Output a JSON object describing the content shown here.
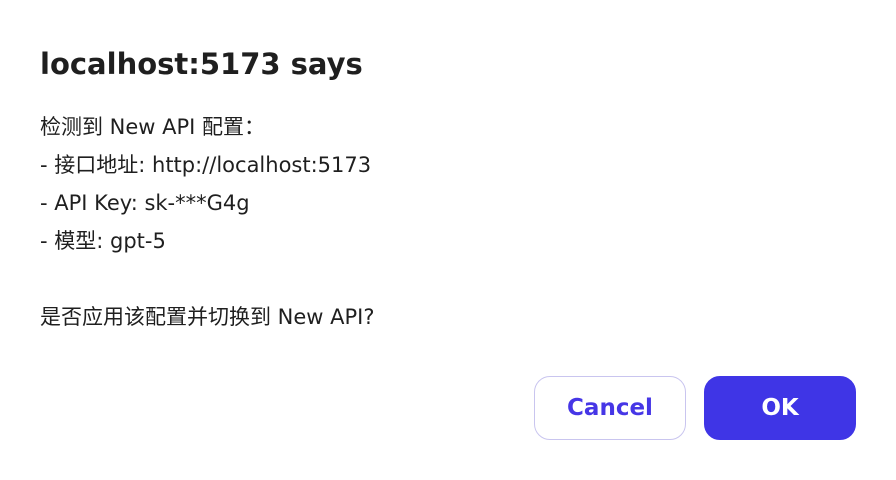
{
  "dialog": {
    "title": "localhost:5173 says",
    "message_lines": [
      "检测到 New API 配置：",
      "- 接口地址: http://localhost:5173",
      "- API Key: sk-***G4g",
      "- 模型: gpt-5",
      "",
      "是否应用该配置并切换到 New API?"
    ],
    "cancel_label": "Cancel",
    "ok_label": "OK"
  },
  "colors": {
    "primary": "#3f35e6",
    "cancel_border": "#c9c5ef",
    "text": "#1f1f1f"
  }
}
